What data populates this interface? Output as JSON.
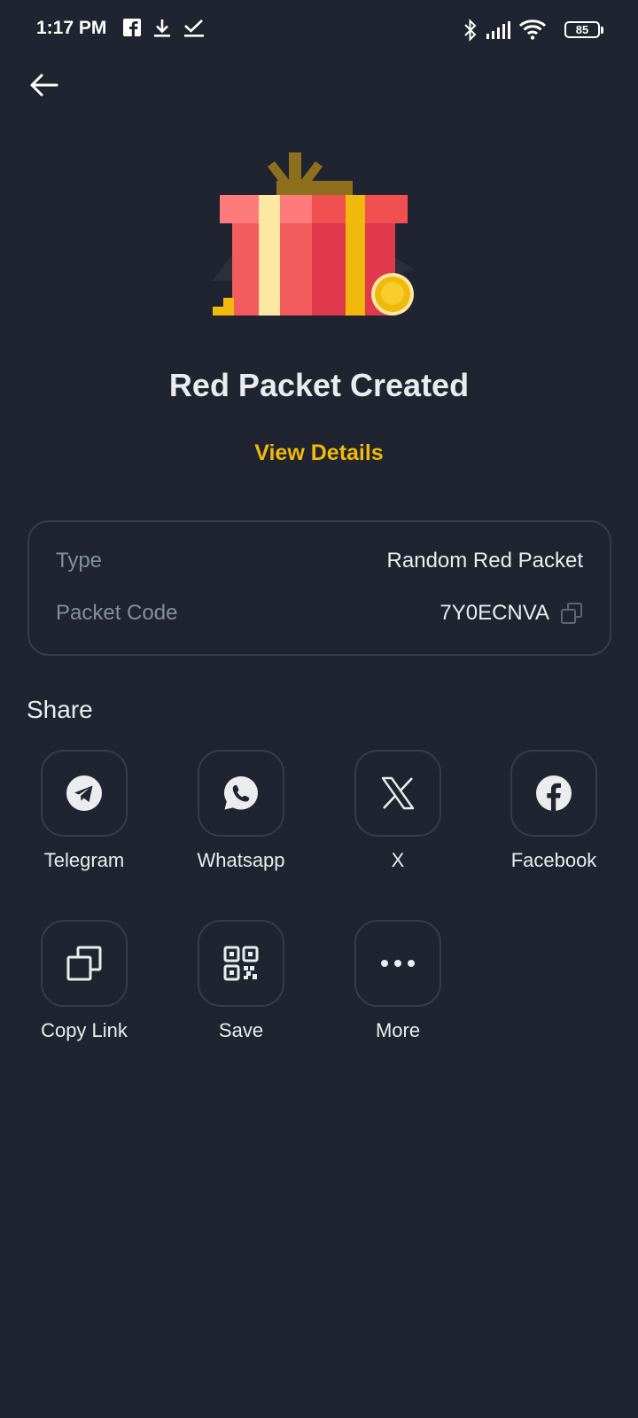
{
  "status_bar": {
    "time": "1:17 PM",
    "battery": "85",
    "icons": [
      "facebook-icon",
      "download-icon",
      "check-icon",
      "bluetooth-icon",
      "signal-icon",
      "wifi-icon",
      "battery-icon"
    ]
  },
  "header": {
    "back_icon": "arrow-left-icon"
  },
  "hero": {
    "illustration": "gift-box-illustration",
    "title": "Red Packet Created",
    "view_details": "View Details"
  },
  "info": {
    "type_label": "Type",
    "type_value": "Random Red Packet",
    "code_label": "Packet Code",
    "code_value": "7Y0ECNVA"
  },
  "share": {
    "title": "Share",
    "items": [
      {
        "label": "Telegram",
        "icon": "telegram-icon"
      },
      {
        "label": "Whatsapp",
        "icon": "whatsapp-icon"
      },
      {
        "label": "X",
        "icon": "x-icon"
      },
      {
        "label": "Facebook",
        "icon": "facebook-icon"
      },
      {
        "label": "Copy Link",
        "icon": "copy-link-icon"
      },
      {
        "label": "Save",
        "icon": "qr-code-icon"
      },
      {
        "label": "More",
        "icon": "more-icon"
      }
    ]
  },
  "colors": {
    "background": "#1f2430",
    "accent": "#f0b90b",
    "muted_text": "#848e9c",
    "border": "#363c48"
  }
}
